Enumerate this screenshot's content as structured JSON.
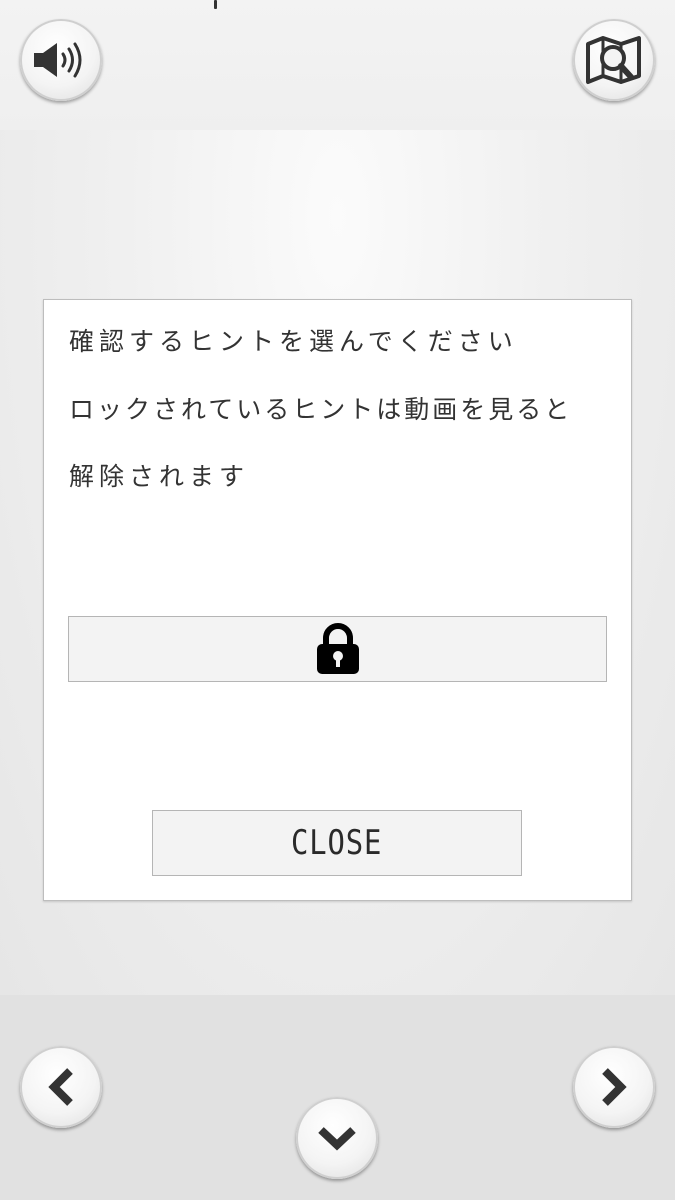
{
  "hint_dialog": {
    "message_lines": [
      "確認するヒントを選んでください",
      "ロックされているヒントは動画を見ると",
      "解除されます"
    ],
    "hint_buttons": [
      {
        "state": "locked",
        "icon": "lock-icon"
      }
    ],
    "close_label": "CLOSE"
  },
  "top_bar": {
    "sound_icon": "speaker-icon",
    "map_icon": "map-search-icon"
  },
  "bottom_nav": {
    "prev_icon": "chevron-left-icon",
    "next_icon": "chevron-right-icon",
    "down_icon": "chevron-down-icon"
  },
  "colors": {
    "dialog_bg": "#ffffff",
    "button_bg": "#f3f3f3",
    "icon": "#333333"
  }
}
